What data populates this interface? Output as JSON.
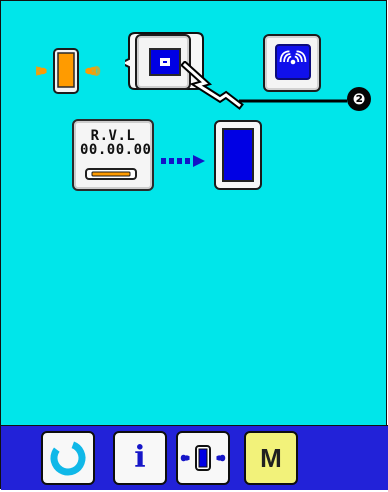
{
  "header": {
    "left_comm_icon": "wireless-device-icon",
    "selected_device_icon": "blue-storage-card-icon",
    "selected_device_label": "",
    "right_button_icon": "wireless-signal-icon"
  },
  "transfer": {
    "source_label_line1": "R.V.L",
    "source_label_line2": "00.00.00",
    "source_icon": "media-slot-icon",
    "arrow_icon": "dotted-arrow-right-icon",
    "target_icon": "device-screen-icon"
  },
  "callout": {
    "number": "❷"
  },
  "bottom_bar": {
    "buttons": [
      {
        "name": "reset",
        "icon": "refresh-icon",
        "label": ""
      },
      {
        "name": "info",
        "icon": "info-icon",
        "label": "i"
      },
      {
        "name": "communication",
        "icon": "communication-icon",
        "label": ""
      },
      {
        "name": "mode",
        "icon": "mode-icon",
        "label": "M"
      }
    ]
  },
  "colors": {
    "background": "#00e6ea",
    "accent_blue": "#0000e4",
    "orange": "#ff9b00",
    "yellow_button": "#f2f27a",
    "bottom_bar": "#2222d8"
  }
}
